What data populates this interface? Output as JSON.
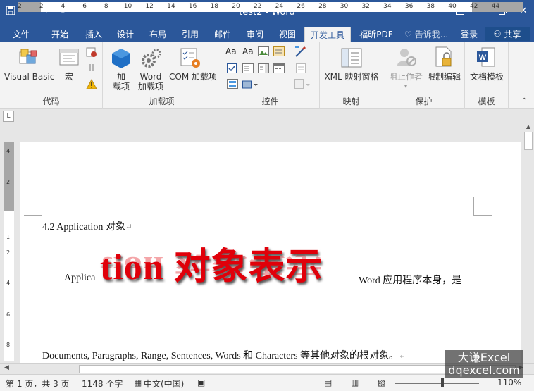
{
  "window": {
    "title": "test2 - Word"
  },
  "tabs": [
    {
      "label": "文件"
    },
    {
      "label": "开始"
    },
    {
      "label": "插入"
    },
    {
      "label": "设计"
    },
    {
      "label": "布局"
    },
    {
      "label": "引用"
    },
    {
      "label": "邮件"
    },
    {
      "label": "审阅"
    },
    {
      "label": "视图"
    },
    {
      "label": "开发工具"
    },
    {
      "label": "福昕PDF"
    }
  ],
  "tell_me": "告诉我...",
  "login": "登录",
  "share": "共享",
  "ribbon": {
    "groups": {
      "code": "代码",
      "addins": "加载项",
      "controls": "控件",
      "mapping": "映射",
      "protect": "保护",
      "templates": "模板"
    },
    "buttons": {
      "vba": "Visual Basic",
      "macro": "宏",
      "addins": "加\n载项",
      "addins_line1": "加",
      "addins_line2": "载项",
      "word_addins_line1": "Word",
      "word_addins_line2": "加载项",
      "com_addins": "COM 加载项",
      "xml_pane": "XML 映射窗格",
      "block_authors": "阻止作者",
      "restrict_edit": "限制编辑",
      "doc_template": "文档模板"
    }
  },
  "ruler": {
    "labels": [
      "2",
      "2",
      "4",
      "6",
      "8",
      "10",
      "12",
      "14",
      "16",
      "18",
      "20",
      "22",
      "24",
      "26",
      "28",
      "30",
      "32",
      "34",
      "36",
      "38",
      "40",
      "42",
      "44"
    ]
  },
  "vruler": {
    "labels": [
      "4",
      "2",
      "1",
      "2",
      "4",
      "6",
      "8"
    ]
  },
  "document": {
    "heading": "4.2 Application  对象",
    "line2_left": "Applica",
    "wordart": "tion  对象表示",
    "line2_right": "Word 应用程序本身，是",
    "line3": "Documents, Paragraphs, Range, Sentences, Words 和 Characters 等其他对象的根对象。"
  },
  "status": {
    "page": "第 1 页，共 3 页",
    "words": "1148 个字",
    "lang": "中文(中国)",
    "zoom": "110%"
  },
  "watermark": {
    "line1": "大谦Excel",
    "line2": "dqexcel.com"
  }
}
